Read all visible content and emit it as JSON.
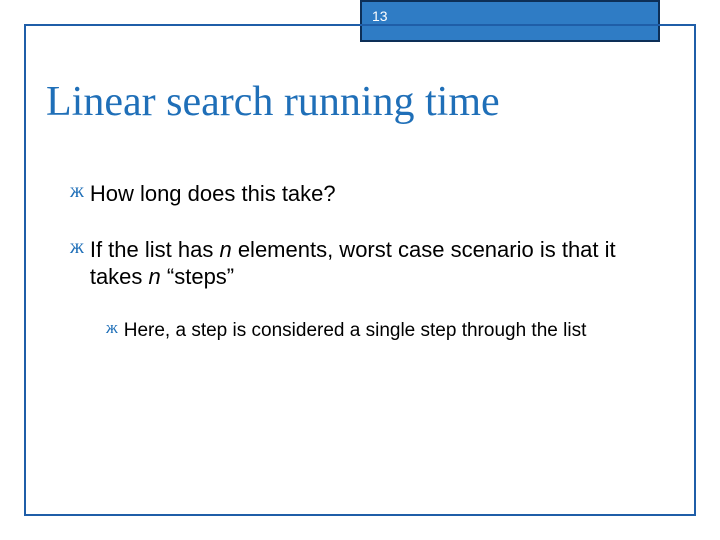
{
  "page_number": "13",
  "title": "Linear search running time",
  "bullets": {
    "b1": {
      "t1": "How long does this take?"
    },
    "b2": {
      "t1": "If the list has ",
      "i1": "n",
      "t2": " elements, worst case scenario is that it takes ",
      "i2": "n",
      "t3": " “steps”"
    },
    "b2a": {
      "t1": "Here, a step is considered a single step through the list"
    }
  },
  "bullet_glyph": "ж"
}
